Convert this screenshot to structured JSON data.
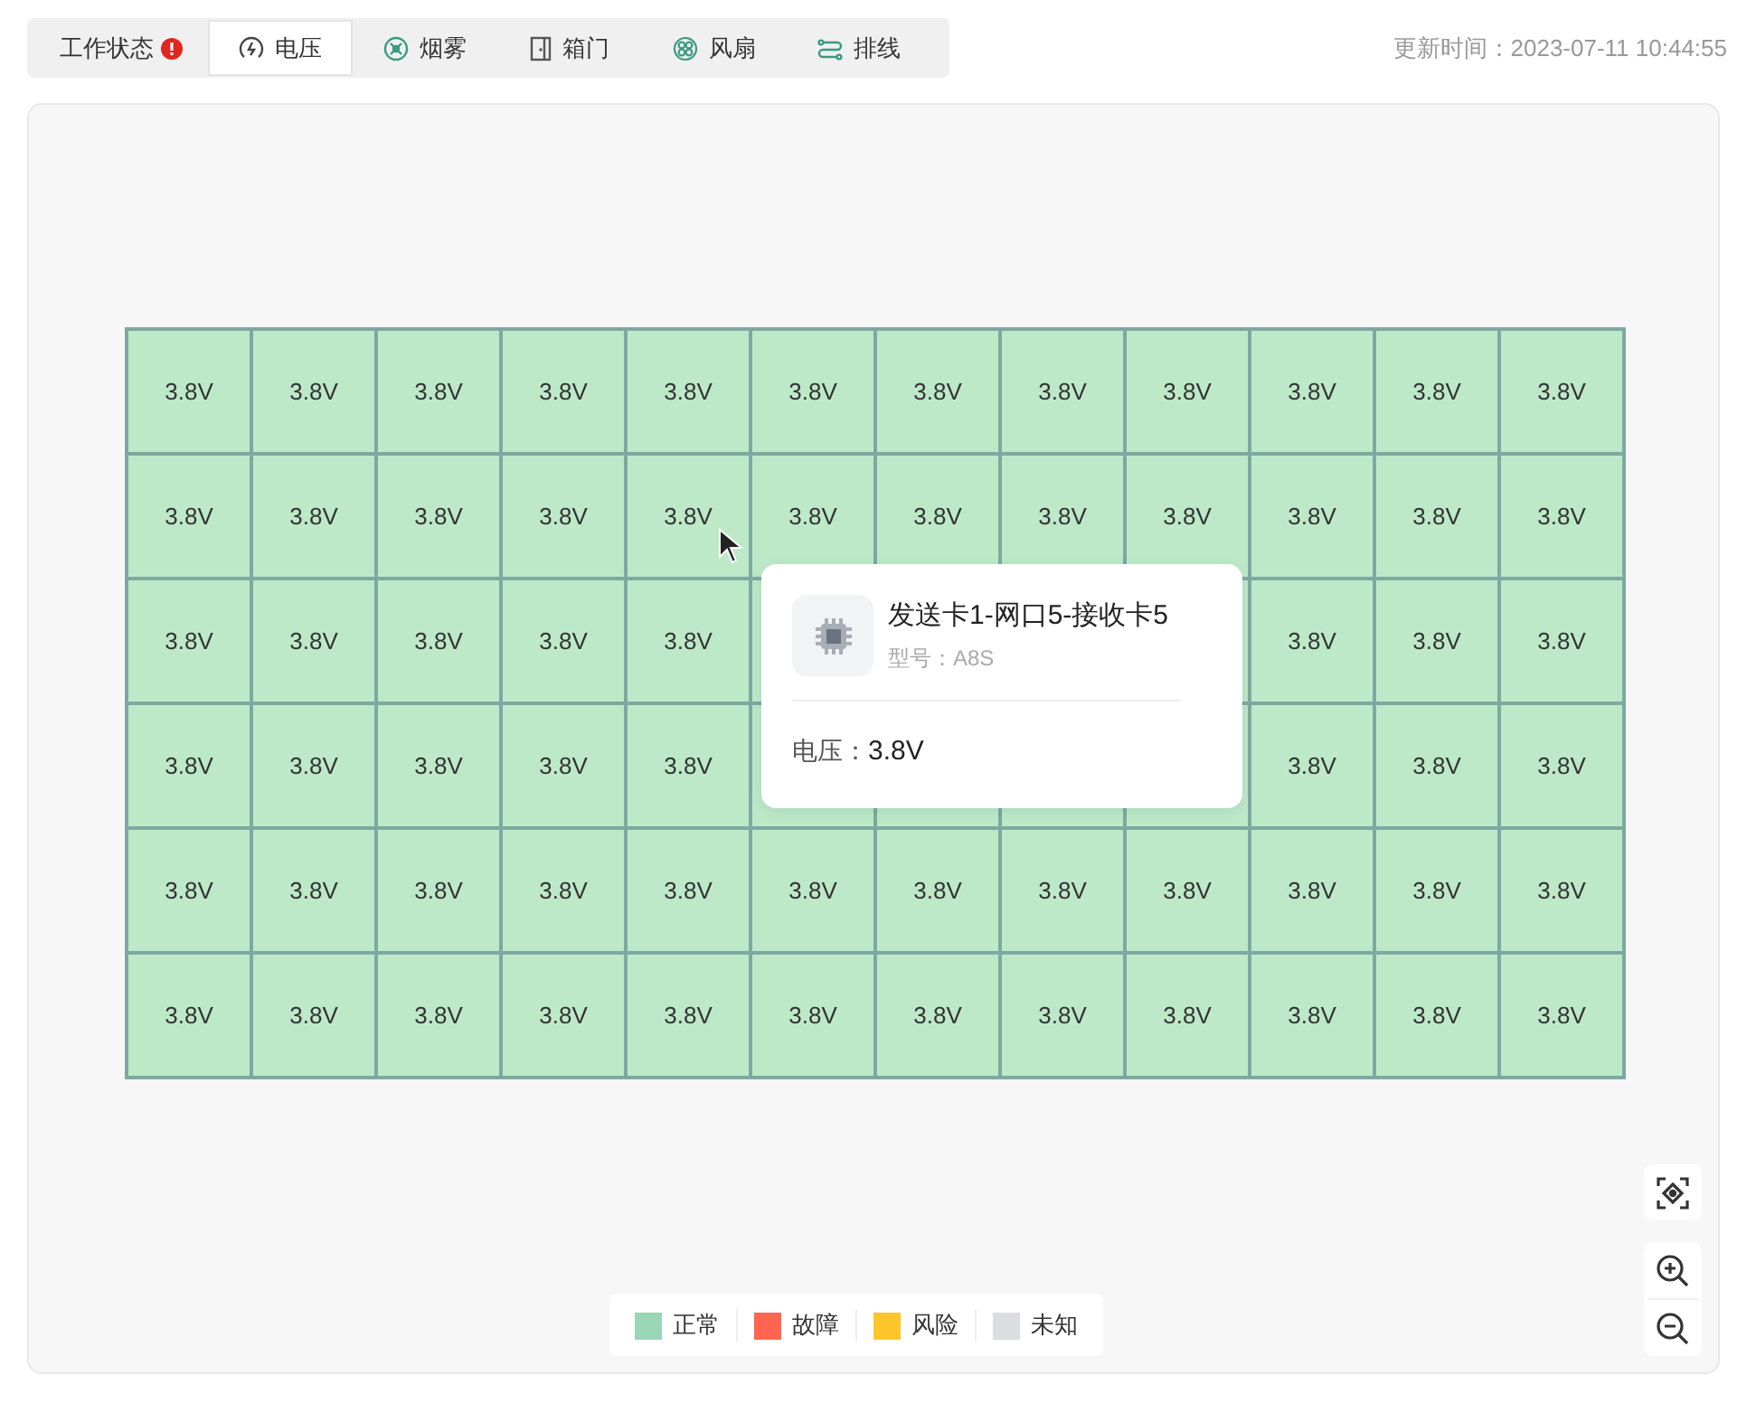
{
  "status_label": {
    "text": "工作状态",
    "alert": true
  },
  "tabs": [
    {
      "label": "电压",
      "kind": "voltage",
      "selected": true
    },
    {
      "label": "烟雾",
      "kind": "smoke",
      "selected": false
    },
    {
      "label": "箱门",
      "kind": "door",
      "selected": false
    },
    {
      "label": "风扇",
      "kind": "fan",
      "selected": false
    },
    {
      "label": "排线",
      "kind": "cable",
      "selected": false
    }
  ],
  "update_time": "更新时间：2023-07-11 10:44:55",
  "grid": {
    "rows": [
      [
        "3.8V",
        "3.8V",
        "3.8V",
        "3.8V",
        "3.8V",
        "3.8V",
        "3.8V",
        "3.8V",
        "3.8V",
        "3.8V",
        "3.8V",
        "3.8V"
      ],
      [
        "3.8V",
        "3.8V",
        "3.8V",
        "3.8V",
        "3.8V",
        "3.8V",
        "3.8V",
        "3.8V",
        "3.8V",
        "3.8V",
        "3.8V",
        "3.8V"
      ],
      [
        "3.8V",
        "3.8V",
        "3.8V",
        "3.8V",
        "3.8V",
        null,
        null,
        null,
        null,
        "3.8V",
        "3.8V",
        "3.8V"
      ],
      [
        "3.8V",
        "3.8V",
        "3.8V",
        "3.8V",
        "3.8V",
        null,
        null,
        null,
        null,
        "3.8V",
        "3.8V",
        "3.8V"
      ],
      [
        "3.8V",
        "3.8V",
        "3.8V",
        "3.8V",
        "3.8V",
        "3.8V",
        "3.8V",
        "3.8V",
        "3.8V",
        "3.8V",
        "3.8V",
        "3.8V"
      ],
      [
        "3.8V",
        "3.8V",
        "3.8V",
        "3.8V",
        "3.8V",
        "3.8V",
        "3.8V",
        "3.8V",
        "3.8V",
        "3.8V",
        "3.8V",
        "3.8V"
      ]
    ]
  },
  "tooltip": {
    "title": "发送卡1-网口5-接收卡5",
    "subtitle": "型号：A8S",
    "fields": [
      {
        "label": "电压：",
        "value": "3.8V"
      }
    ]
  },
  "legend": [
    {
      "label": "正常",
      "color": "#9ad5b6"
    },
    {
      "label": "故障",
      "color": "#ff6550"
    },
    {
      "label": "风险",
      "color": "#ffc62b"
    },
    {
      "label": "未知",
      "color": "#dcdde0"
    }
  ]
}
